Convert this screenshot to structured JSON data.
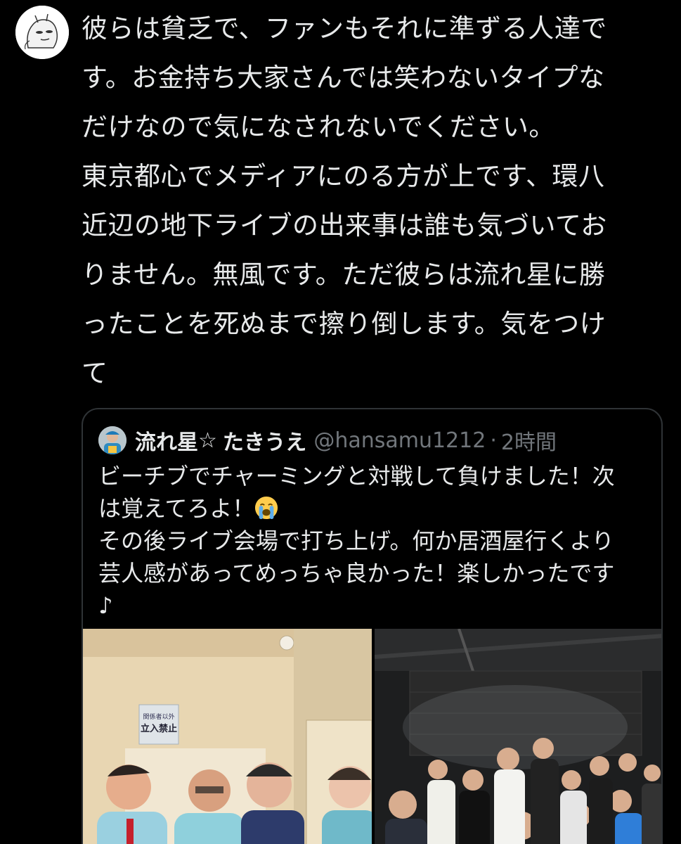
{
  "tweet": {
    "avatar_icon": "meme-character-avatar",
    "lines": [
      "彼らは貧乏で、ファンもそれに準ずる人達で",
      "す。お金持ち大家さんでは笑わないタイプな",
      "だけなので気になされないでください。",
      "東京都心でメディアにのる方が上です、環八",
      "近辺の地下ライブの出来事は誰も気づいてお",
      "りません。無風です。ただ彼らは流れ星に勝",
      "ったことを死ぬまで擦り倒します。気をつけ",
      "て"
    ]
  },
  "quote": {
    "display_name": "流れ星",
    "star": "☆",
    "display_name_2": "たきうえ",
    "handle": "@hansamu1212",
    "dot": "·",
    "time": "2時間",
    "lines": [
      "ビーチブでチャーミングと対戦して負けました！次",
      "は覚えてろよ！",
      "その後ライブ会場で打ち上げ。何か居酒屋行くより",
      "芸人感があってめっちゃ良かった！楽しかったです",
      "♪"
    ],
    "emoji": "loudly-crying-face-icon",
    "photos": {
      "left_sign_line1": "関係者以外",
      "left_sign_line2": "立入禁止"
    }
  },
  "colors": {
    "background": "#000000",
    "text": "#e7e9ea",
    "secondary": "#71767b",
    "border": "#2f3336"
  }
}
